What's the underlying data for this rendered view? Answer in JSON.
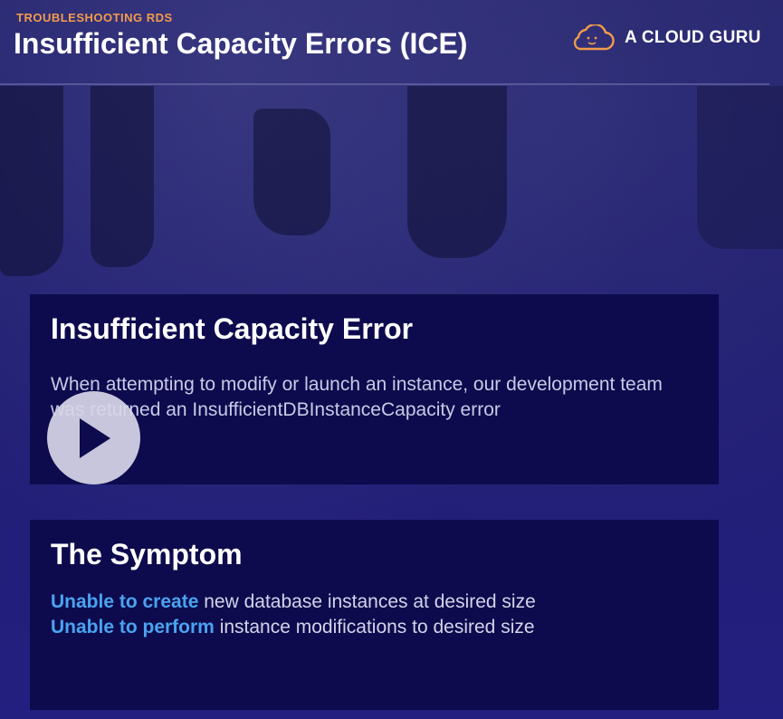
{
  "header": {
    "kicker": "TROUBLESHOOTING RDS",
    "title": "Insufficient Capacity Errors (ICE)",
    "logo_text": "A CLOUD GURU"
  },
  "panels": [
    {
      "heading": "Insufficient Capacity Error",
      "body": "When attempting to modify or launch an instance, our development team was returned an InsufficientDBInstanceCapacity error"
    },
    {
      "heading": "The Symptom",
      "items": [
        {
          "highlight": "Unable to create",
          "rest": " new database instances at desired size"
        },
        {
          "highlight": "Unable to perform",
          "rest": " instance modifications to desired size"
        }
      ]
    }
  ],
  "player": {
    "icon": "play-icon"
  },
  "colors": {
    "accent_orange": "#f29b4c",
    "highlight_blue": "#4aa3f0",
    "panel_bg": "#0d0b4d",
    "page_bg": "#1f1e6b"
  }
}
